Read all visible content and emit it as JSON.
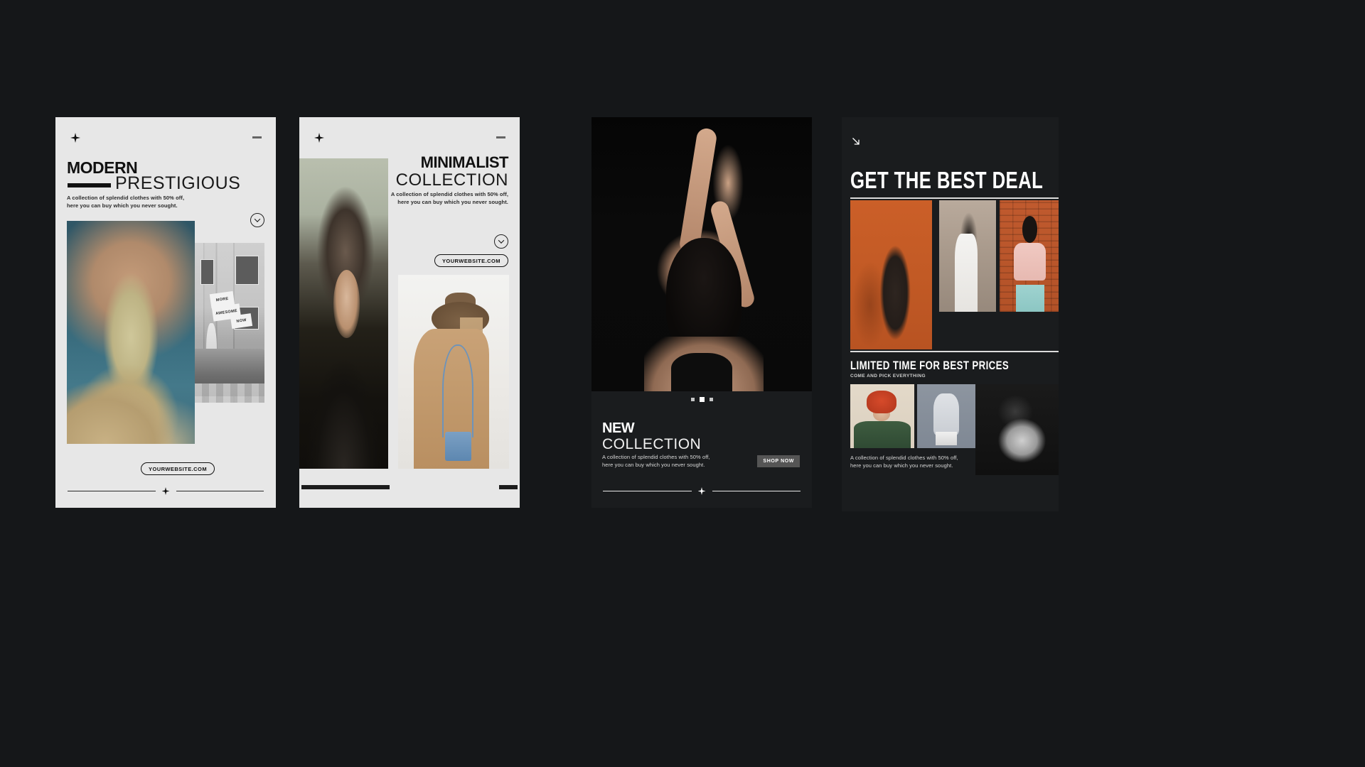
{
  "page": {
    "background_color": "#151719",
    "light_card_color": "#e7e7e7",
    "dark_card_color": "#1a1c1e"
  },
  "shared": {
    "description": "A collection of splendid clothes with 50% off,\nhere you can buy which you never sought.",
    "website_badge": "YOURWEBSITE.COM",
    "star_icon": "four-point-star",
    "dash_icon": "dash-mark"
  },
  "cards": [
    {
      "id": "modern-prestigious",
      "theme": "light",
      "star_icon": "four-point-star",
      "dash_icon": "dash-mark",
      "title_bold": "MODERN",
      "title_thin": "PRESTIGIOUS",
      "description": "A collection of splendid clothes with 50% off,\nhere you can buy which you never sought.",
      "chevron_icon": "chevron-down-icon",
      "badge": "YOURWEBSITE.COM",
      "images": [
        {
          "name": "woman-olive-dress-on-rock",
          "alt": "Woman in olive dress standing on rock by the sea"
        },
        {
          "name": "bw-street-scene",
          "alt": "Black and white street scene with vintage car",
          "sign_lines": [
            "MORE",
            "AWESOME",
            "NOW"
          ]
        }
      ]
    },
    {
      "id": "minimalist-collection",
      "theme": "light",
      "star_icon": "four-point-star",
      "dash_icon": "dash-mark",
      "title_bold": "MINIMALIST",
      "title_thin": "COLLECTION",
      "description": "A collection of splendid clothes with 50% off,\nhere you can buy which you never sought.",
      "chevron_icon": "chevron-down-icon",
      "badge": "YOURWEBSITE.COM",
      "images": [
        {
          "name": "dark-portrait-woman",
          "alt": "Moody portrait of woman in dark clothing"
        },
        {
          "name": "woman-brown-hat-camel-coat",
          "alt": "Woman from behind wearing brown hat, camel coat and blue crossbody bag"
        }
      ]
    },
    {
      "id": "new-collection",
      "theme": "dark",
      "title_bold": "NEW",
      "title_thin": "COLLECTION",
      "description": "A collection of splendid clothes with 50% off,\nhere you can buy which you never sought.",
      "shop_button": "SHOP NOW",
      "carousel": {
        "total": 3,
        "active_index": 1
      },
      "star_icon": "four-point-star",
      "images": [
        {
          "name": "woman-arms-raised-dark",
          "alt": "Woman with arms raised against dark background"
        }
      ]
    },
    {
      "id": "get-the-best-deal",
      "theme": "dark",
      "arrow_icon": "arrow-down-right-icon",
      "title": "GET THE BEST DEAL",
      "subtitle_heading": "LIMITED TIME FOR BEST PRICES",
      "subtitle_text": "COME AND PICK EVERYTHING",
      "description": "A collection of splendid clothes with 50% off,\nhere you can buy which you never sought.",
      "images": [
        {
          "name": "woman-orange-backdrop",
          "alt": "Woman dancing against orange backdrop with shadow"
        },
        {
          "name": "woman-white-outfit-wall",
          "alt": "Woman in white outfit against textured wall"
        },
        {
          "name": "woman-pink-top-brick-wall",
          "alt": "Woman in pink top leaning on brick wall"
        },
        {
          "name": "woman-red-hat-green-sweater",
          "alt": "Woman wearing red hat over eyes and green sweater"
        },
        {
          "name": "man-grey-hoodie-seated",
          "alt": "Man in grey hoodie seated on white block"
        },
        {
          "name": "bw-woman-bare-shoulder",
          "alt": "Black and white photo of woman with bare shoulder"
        }
      ]
    }
  ]
}
